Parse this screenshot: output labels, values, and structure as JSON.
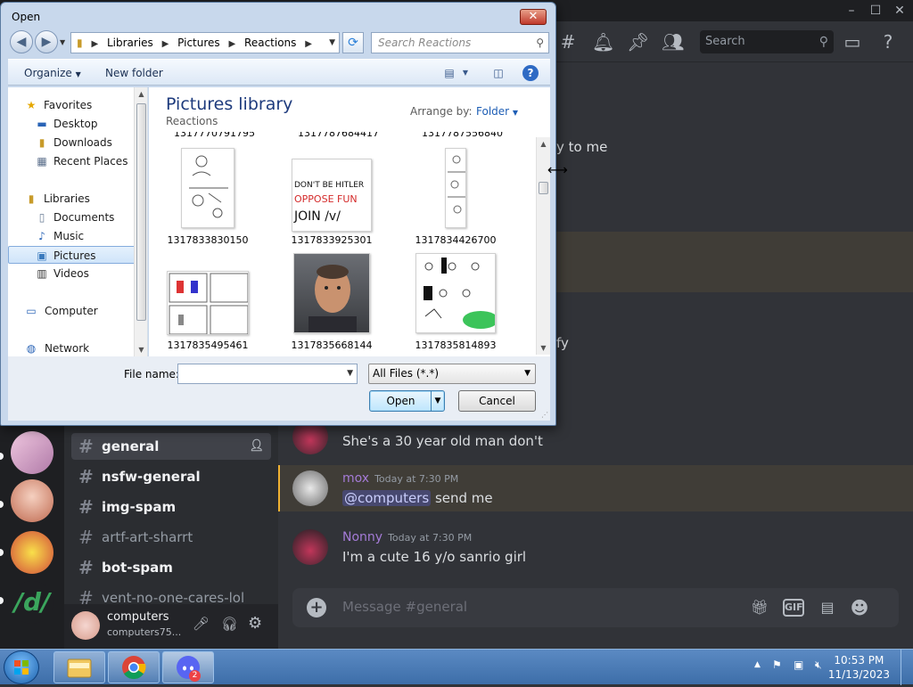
{
  "discord": {
    "search_placeholder": "Search",
    "channels": [
      {
        "name": "general",
        "state": "active"
      },
      {
        "name": "nsfw-general",
        "state": "unread"
      },
      {
        "name": "img-spam",
        "state": "unread"
      },
      {
        "name": "artf-art-sharrt",
        "state": "muted"
      },
      {
        "name": "bot-spam",
        "state": "unread"
      },
      {
        "name": "vent-no-one-cares-lol",
        "state": "muted"
      }
    ],
    "server_label": "/d/",
    "user": {
      "name": "computers",
      "tag": "computers75..."
    },
    "partial_messages": [
      "y to me",
      "fy"
    ],
    "messages": [
      {
        "text": "She's a 30 year old man don't"
      },
      {
        "author": "mox",
        "time": "Today at 7:30 PM",
        "mention": "@computers",
        "text": "send me"
      },
      {
        "author": "Nonny",
        "time": "Today at 7:30 PM",
        "text": "I'm a cute 16 y/o sanrio girl"
      }
    ],
    "composer_placeholder": "Message #general",
    "gif_label": "GIF"
  },
  "taskbar": {
    "time": "10:53 PM",
    "date": "11/13/2023",
    "discord_badge": "2"
  },
  "dialog": {
    "title": "Open",
    "close_label": "✕",
    "breadcrumb": [
      "Libraries",
      "Pictures",
      "Reactions"
    ],
    "search_placeholder": "Search Reactions",
    "toolbar": {
      "organize": "Organize",
      "new_folder": "New folder"
    },
    "nav": {
      "favorites": "Favorites",
      "desktop": "Desktop",
      "downloads": "Downloads",
      "recent": "Recent Places",
      "libraries": "Libraries",
      "documents": "Documents",
      "music": "Music",
      "pictures": "Pictures",
      "videos": "Videos",
      "computer": "Computer",
      "network": "Network"
    },
    "library_title": "Pictures library",
    "library_subtitle": "Reactions",
    "arrange_label": "Arrange by:",
    "arrange_value": "Folder",
    "cutoff_labels": [
      "1317770791795",
      "1317787684417",
      "1317787556840"
    ],
    "files": [
      {
        "name": "1317833830150"
      },
      {
        "name": "1317833925301",
        "caption_1": "DON'T BE HITLER",
        "caption_2": "OPPOSE FUN",
        "caption_3": "JOIN /v/"
      },
      {
        "name": "1317834426700"
      },
      {
        "name": "1317835495461"
      },
      {
        "name": "1317835668144"
      },
      {
        "name": "1317835814893"
      }
    ],
    "file_name_label": "File name:",
    "file_name_value": "",
    "file_type": "All Files (*.*)",
    "open_label": "Open",
    "cancel_label": "Cancel"
  }
}
